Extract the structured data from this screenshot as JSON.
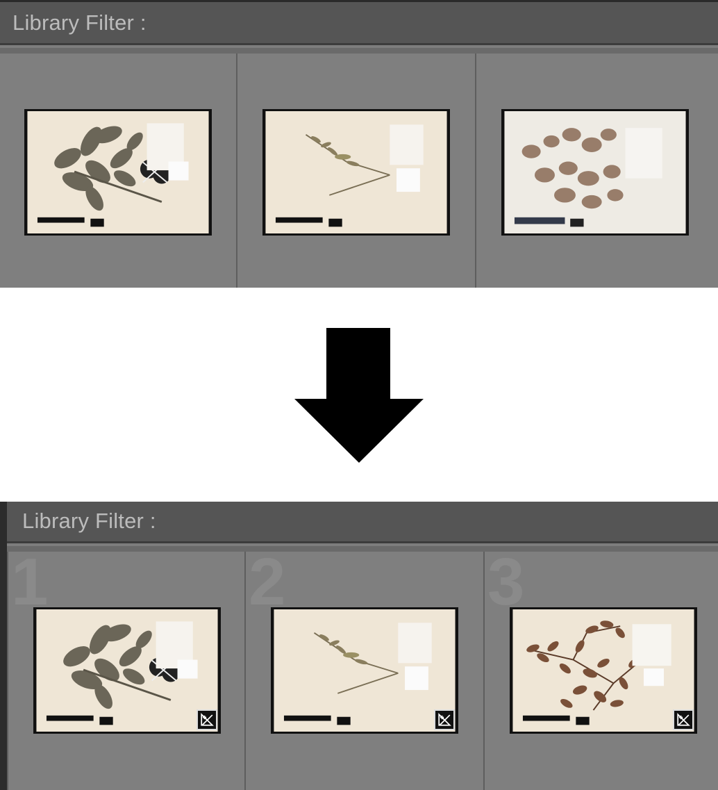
{
  "before": {
    "filter_label": "Library Filter :",
    "thumbnails": [
      {
        "subject": "herbarium-specimen-broadleaf"
      },
      {
        "subject": "herbarium-specimen-slender"
      },
      {
        "subject": "herbarium-specimen-blurred-leaves"
      }
    ]
  },
  "after": {
    "filter_label": "Library Filter :",
    "cell_numbers": [
      "1",
      "2",
      "3"
    ],
    "thumbnails": [
      {
        "subject": "herbarium-specimen-broadleaf",
        "badge": "develop-adjustment-icon"
      },
      {
        "subject": "herbarium-specimen-slender",
        "badge": "develop-adjustment-icon"
      },
      {
        "subject": "herbarium-specimen-leafy-branch",
        "badge": "develop-adjustment-icon"
      }
    ]
  },
  "transition_icon": "down-arrow-icon",
  "colors": {
    "panel_bg": "#7d7d7d",
    "filter_bar_bg": "#555555",
    "filter_text": "#bcbcbc",
    "paper": "#efe6d6",
    "leaf_gray": "#6b6658",
    "leaf_brown": "#7a5038"
  }
}
